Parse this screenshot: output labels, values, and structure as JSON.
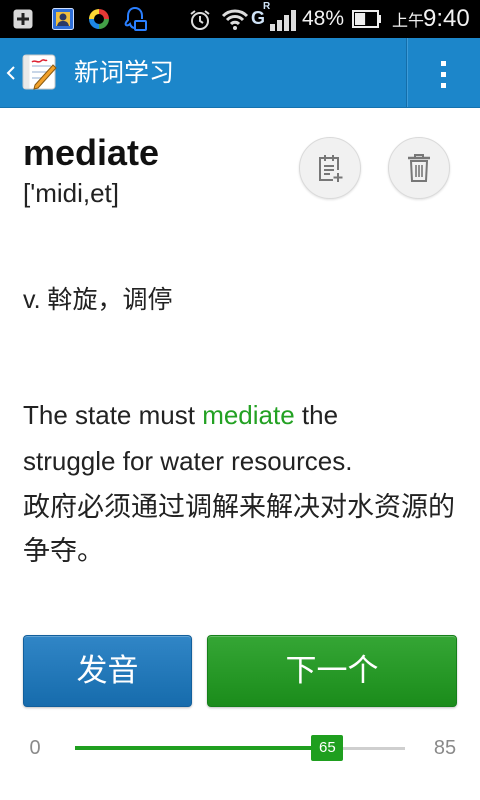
{
  "status_bar": {
    "icons": {
      "left": [
        "add-box-icon",
        "contact-card-icon",
        "sync-circle-icon",
        "notification-bot-icon"
      ],
      "right": [
        "alarm-clock-icon",
        "wifi-icon",
        "signal-bars-icon",
        "battery-icon"
      ]
    },
    "network_type": "G",
    "network_roaming": "R",
    "battery_percent": "48%",
    "battery_level": 0.48,
    "time_period": "上午",
    "time": "9:40"
  },
  "app_bar": {
    "title": "新词学习",
    "back_icon": "chevron-left-icon",
    "app_icon": "notepad-pencil-icon",
    "menu_icon": "overflow-menu-icon"
  },
  "word": {
    "text": "mediate",
    "phonetic": "['midi,et]",
    "add_icon": "add-to-notes-icon",
    "delete_icon": "trash-icon"
  },
  "definition": "v. 斡旋，调停",
  "example": {
    "before": "The state must ",
    "highlight": "mediate",
    "after": " the struggle for water resources.",
    "translation": "政府必须通过调解来解决对水资源的争夺。"
  },
  "buttons": {
    "pronounce": "发音",
    "next": "下一个"
  },
  "progress": {
    "min": 0,
    "max": 85,
    "value": 65
  },
  "colors": {
    "app_bar": "#1c86ca",
    "pronounce_button": "#1978c0",
    "next_button": "#1e9c1e",
    "highlight": "#23a123",
    "slider_accent": "#1f9f1f"
  }
}
